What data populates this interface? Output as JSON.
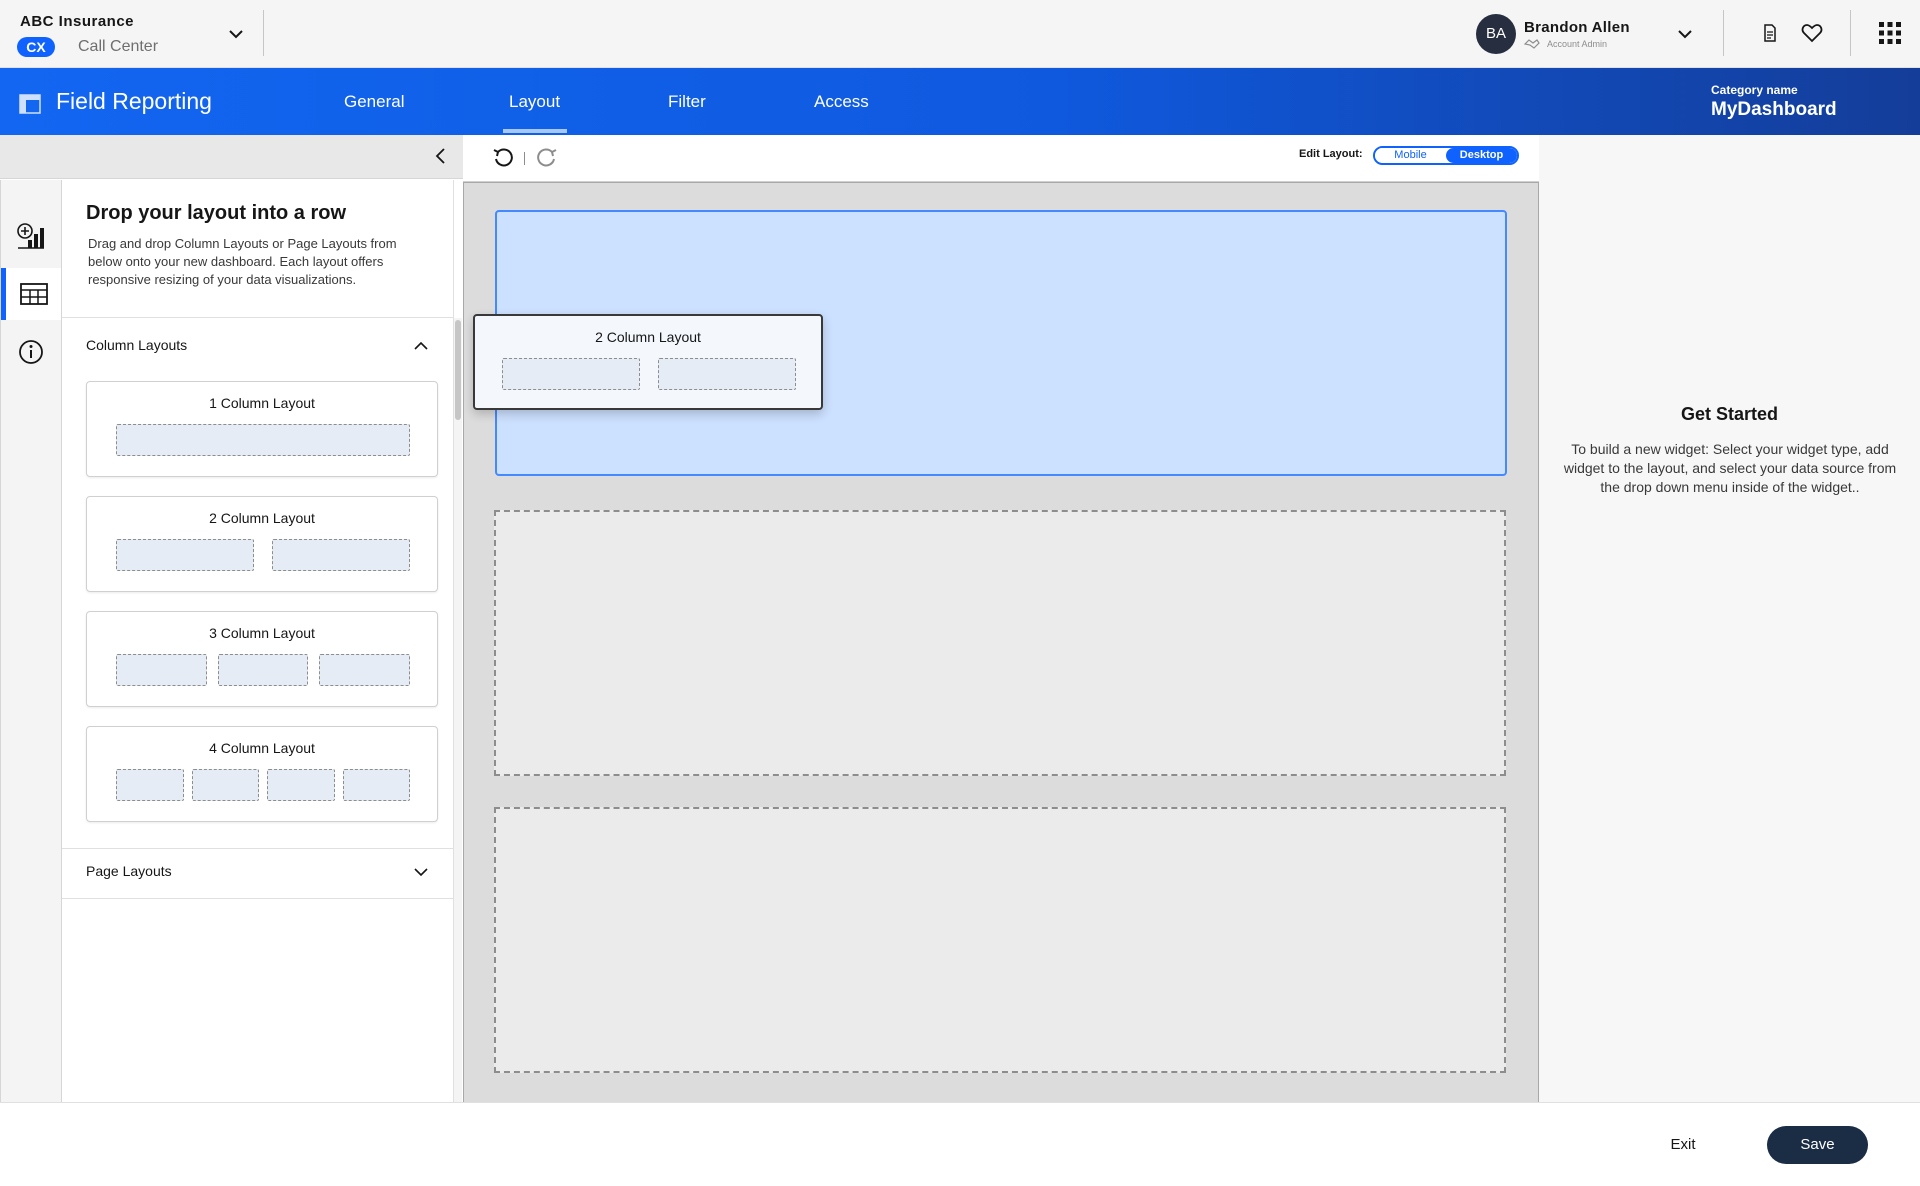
{
  "org": {
    "name": "ABC Insurance",
    "badge": "CX",
    "subtitle": "Call Center"
  },
  "user": {
    "initials": "BA",
    "name": "Brandon Allen",
    "role": "Account Admin"
  },
  "header": {
    "app_title": "Field Reporting",
    "tabs": [
      {
        "label": "General"
      },
      {
        "label": "Layout",
        "active": true
      },
      {
        "label": "Filter"
      },
      {
        "label": "Access"
      }
    ],
    "category_label": "Category name",
    "category_value": "MyDashboard"
  },
  "left_panel": {
    "title": "Drop your layout into a row",
    "description": "Drag and drop Column Layouts or Page Layouts from below onto your new dashboard. Each layout offers responsive resizing of your data visualizations.",
    "column_section": {
      "label": "Column Layouts",
      "expanded": true
    },
    "page_section": {
      "label": "Page Layouts",
      "expanded": false
    },
    "layouts": [
      {
        "title": "1 Column Layout",
        "columns": 1
      },
      {
        "title": "2 Column Layout",
        "columns": 2
      },
      {
        "title": "3 Column Layout",
        "columns": 3
      },
      {
        "title": "4 Column Layout",
        "columns": 4
      }
    ]
  },
  "canvas": {
    "edit_label": "Edit Layout:",
    "toggle": {
      "mobile": "Mobile",
      "desktop": "Desktop",
      "selected": "Desktop"
    },
    "dragging_card": {
      "title": "2 Column Layout",
      "columns": 2
    }
  },
  "right_panel": {
    "title": "Get Started",
    "text": "To build a new widget: Select your widget type, add widget to the layout, and select your data source from the drop down menu inside of the widget.."
  },
  "footer": {
    "exit_label": "Exit",
    "save_label": "Save"
  },
  "colors": {
    "primary": "#0f62fe",
    "save_button": "#1b2d45",
    "drop_highlight": "#cce0ff"
  }
}
